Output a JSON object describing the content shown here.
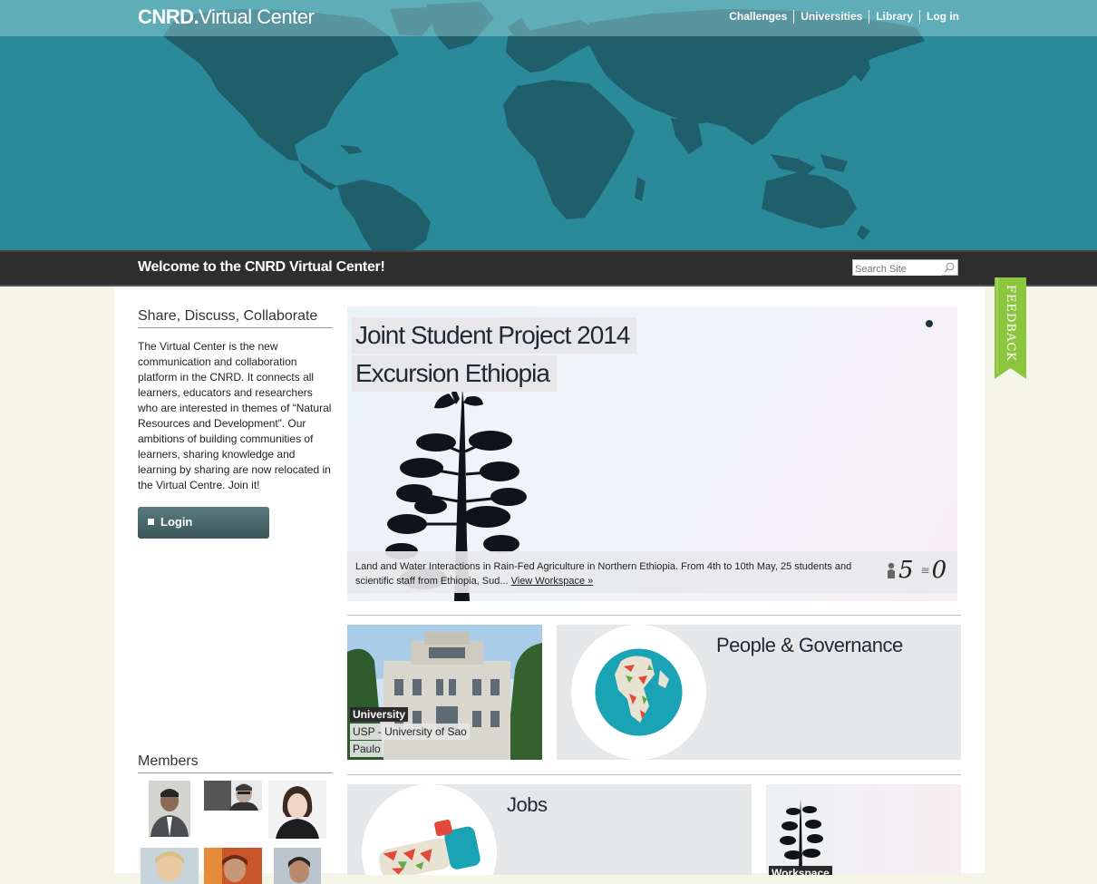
{
  "site": {
    "logo_bold": "CNRD.",
    "logo_rest": "Virtual Center"
  },
  "nav": [
    {
      "label": "Challenges"
    },
    {
      "label": "Universities"
    },
    {
      "label": "Library"
    },
    {
      "label": "Log in"
    }
  ],
  "welcome": "Welcome to the CNRD Virtual Center!",
  "search": {
    "placeholder": "Search Site"
  },
  "sidebar": {
    "heading": "Share, Discuss, Collaborate",
    "intro": "The Virtual Center is the new communication and collaboration platform in the CNRD. It connects all learners, educators and researchers who are interested in themes of “Natural Resources and Development”. Our ambitions of building communities of learners, sharing knowledge and learning by sharing are now relocated in the Virtual Centre. Join it!",
    "login_label": "Login",
    "members_heading": "Members"
  },
  "featured": {
    "title_line1": "Joint Student Project 2014",
    "title_line2": "Excursion Ethiopia",
    "caption": "Land and Water Interactions in Rain-Fed Agriculture in Northern Ethiopia. From 4th to 10th May, 25 students and scientific staff from Ethiopia, Sud... ",
    "link": "View Workspace »",
    "members_count": "5",
    "posts_count": "0"
  },
  "tiles": {
    "university_tag": "University",
    "university_name_line1": "USP - University of Sao",
    "university_name_line2": "Paulo",
    "people_governance": "People & Governance",
    "jobs": "Jobs",
    "workspace_tag": "Workspace"
  },
  "feedback_label": "FEEDBACK",
  "colors": {
    "map_ocean": "#2b8a9a",
    "map_land": "#1f5f6c",
    "welcome_bar": "#2e2e2e",
    "login_button": "#4a6a6e",
    "feedback_tab": "#8cc63f",
    "page_bg": "#f5f5e8"
  }
}
